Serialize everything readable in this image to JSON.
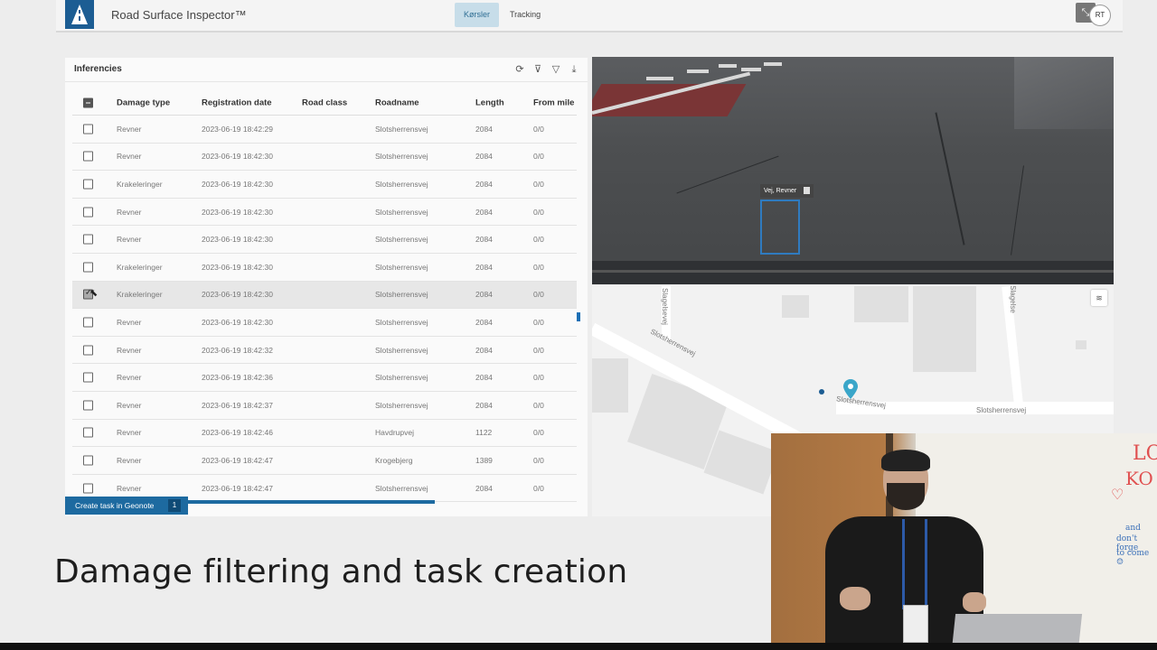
{
  "app": {
    "title": "Road Surface Inspector™",
    "tabs": [
      {
        "label": "Kørsler",
        "active": true
      },
      {
        "label": "Tracking",
        "active": false
      }
    ],
    "avatar_initials": "RT",
    "accent_color": "#1c5d93"
  },
  "inferences": {
    "title": "Inferencies",
    "toolbar_icons": [
      "refresh-icon",
      "clear-filter-icon",
      "filter-icon",
      "download-icon"
    ],
    "columns": [
      "Damage type",
      "Registration date",
      "Road class",
      "Roadname",
      "Length",
      "From mile"
    ],
    "rows": [
      {
        "type": "Revner",
        "date": "2023-06-19 18:42:29",
        "road_class": "",
        "road": "Slotsherrensvej",
        "length": "2084",
        "from_mile": "0/0",
        "checked": false
      },
      {
        "type": "Revner",
        "date": "2023-06-19 18:42:30",
        "road_class": "",
        "road": "Slotsherrensvej",
        "length": "2084",
        "from_mile": "0/0",
        "checked": false
      },
      {
        "type": "Krakeleringer",
        "date": "2023-06-19 18:42:30",
        "road_class": "",
        "road": "Slotsherrensvej",
        "length": "2084",
        "from_mile": "0/0",
        "checked": false
      },
      {
        "type": "Revner",
        "date": "2023-06-19 18:42:30",
        "road_class": "",
        "road": "Slotsherrensvej",
        "length": "2084",
        "from_mile": "0/0",
        "checked": false
      },
      {
        "type": "Revner",
        "date": "2023-06-19 18:42:30",
        "road_class": "",
        "road": "Slotsherrensvej",
        "length": "2084",
        "from_mile": "0/0",
        "checked": false
      },
      {
        "type": "Krakeleringer",
        "date": "2023-06-19 18:42:30",
        "road_class": "",
        "road": "Slotsherrensvej",
        "length": "2084",
        "from_mile": "0/0",
        "checked": false
      },
      {
        "type": "Krakeleringer",
        "date": "2023-06-19 18:42:30",
        "road_class": "",
        "road": "Slotsherrensvej",
        "length": "2084",
        "from_mile": "0/0",
        "checked": true
      },
      {
        "type": "Revner",
        "date": "2023-06-19 18:42:30",
        "road_class": "",
        "road": "Slotsherrensvej",
        "length": "2084",
        "from_mile": "0/0",
        "checked": false
      },
      {
        "type": "Revner",
        "date": "2023-06-19 18:42:32",
        "road_class": "",
        "road": "Slotsherrensvej",
        "length": "2084",
        "from_mile": "0/0",
        "checked": false
      },
      {
        "type": "Revner",
        "date": "2023-06-19 18:42:36",
        "road_class": "",
        "road": "Slotsherrensvej",
        "length": "2084",
        "from_mile": "0/0",
        "checked": false
      },
      {
        "type": "Revner",
        "date": "2023-06-19 18:42:37",
        "road_class": "",
        "road": "Slotsherrensvej",
        "length": "2084",
        "from_mile": "0/0",
        "checked": false
      },
      {
        "type": "Revner",
        "date": "2023-06-19 18:42:46",
        "road_class": "",
        "road": "Havdrupvej",
        "length": "1122",
        "from_mile": "0/0",
        "checked": false
      },
      {
        "type": "Revner",
        "date": "2023-06-19 18:42:47",
        "road_class": "",
        "road": "Krogebjerg",
        "length": "1389",
        "from_mile": "0/0",
        "checked": false
      },
      {
        "type": "Revner",
        "date": "2023-06-19 18:42:47",
        "road_class": "",
        "road": "Slotsherrensvej",
        "length": "2084",
        "from_mile": "0/0",
        "checked": false
      }
    ],
    "create_task_label": "Create task in Geonote",
    "selected_count": "1"
  },
  "camera": {
    "detection_label": "Vej, Revner"
  },
  "map": {
    "labels": {
      "road_diagonal": "Slotsherrensvej",
      "road_near_pin": "Slotsherrensvej",
      "road_right": "Slotsherrensvej",
      "side_road_left": "Slagelsevej",
      "side_road_right": "Slagelse"
    }
  },
  "slide": {
    "caption": "Damage filtering and task creation"
  },
  "whiteboard": {
    "lines": [
      "LO",
      "KO",
      "♡",
      "and",
      "don't forge",
      "to come ☺"
    ]
  }
}
